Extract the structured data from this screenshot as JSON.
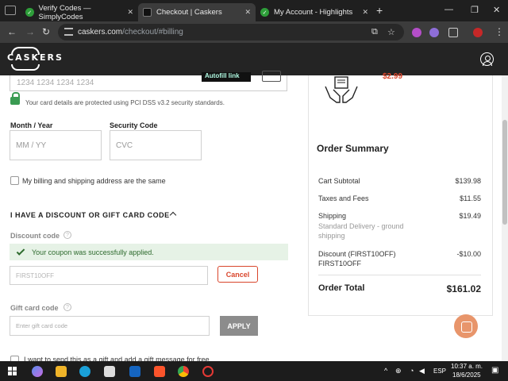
{
  "browser": {
    "tabs": [
      {
        "title": "Verify Codes — SimplyCodes",
        "active": false
      },
      {
        "title": "Checkout | Caskers",
        "active": true
      },
      {
        "title": "My Account - Highlights",
        "active": false
      }
    ],
    "url_host": "caskers.com",
    "url_path": "/checkout/#billing"
  },
  "site": {
    "logo": "CASKERS"
  },
  "payment": {
    "card_placeholder": "1234 1234 1234 1234",
    "afterpay_label": "Autofill link",
    "secure_text": "Your card details are protected using PCI DSS v3.2 security standards.",
    "month_year_label": "Month / Year",
    "month_year_placeholder": "MM / YY",
    "security_code_label": "Security Code",
    "security_code_placeholder": "CVC",
    "same_address_label": "My billing and shipping address are the same"
  },
  "discount": {
    "section_title": "I HAVE A DISCOUNT OR GIFT CARD CODE",
    "discount_label": "Discount code",
    "success_message": "Your coupon was successfully applied.",
    "discount_value": "FIRST10OFF",
    "cancel_label": "Cancel",
    "gift_label": "Gift card code",
    "gift_placeholder": "Enter gift card code",
    "apply_label": "APPLY",
    "gift_message_label": "I want to send this as a gift and add a gift message for free"
  },
  "summary": {
    "product_price": "$2.99",
    "title": "Order Summary",
    "rows": [
      {
        "label": "Cart Subtotal",
        "value": "$139.98"
      },
      {
        "label": "Taxes and Fees",
        "value": "$11.55"
      },
      {
        "label": "Shipping",
        "value": "$19.49",
        "sub": "Standard Delivery - ground shipping"
      },
      {
        "label": "Discount (FIRST10OFF)",
        "value": "-$10.00",
        "sub": "FIRST10OFF"
      }
    ],
    "total_label": "Order Total",
    "total_value": "$161.02"
  },
  "taskbar": {
    "lang": "ESP",
    "time": "10:37 a. m.",
    "date": "18/6/2025"
  },
  "colors": {
    "accent_red": "#d9452b",
    "success_green": "#2d6a2d",
    "header_bg": "#242424",
    "chat_orange": "#e8956b"
  }
}
